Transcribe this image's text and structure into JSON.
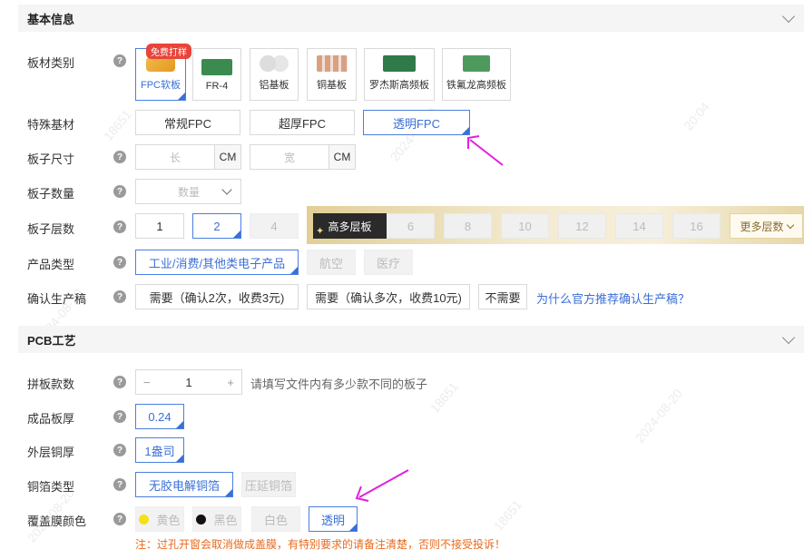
{
  "sections": {
    "basic_title": "基本信息",
    "pcb_title": "PCB工艺"
  },
  "help_glyph": "?",
  "material": {
    "label": "板材类别",
    "badge": "免费打样",
    "options": [
      "FPC软板",
      "FR-4",
      "铝基板",
      "铜基板",
      "罗杰斯高频板",
      "铁氟龙高频板"
    ],
    "selected": "FPC软板"
  },
  "special_substrate": {
    "label": "特殊基材",
    "options": [
      "常规FPC",
      "超厚FPC",
      "透明FPC"
    ],
    "selected": "透明FPC"
  },
  "board_size": {
    "label": "板子尺寸",
    "length_placeholder": "长",
    "width_placeholder": "宽",
    "unit": "CM"
  },
  "board_quantity": {
    "label": "板子数量",
    "placeholder": "数量"
  },
  "layers": {
    "label": "板子层数",
    "options": [
      "1",
      "2",
      "4"
    ],
    "selected": "2",
    "high_multi_label": "高多层板",
    "high_options": [
      "6",
      "8",
      "10",
      "12",
      "14",
      "16"
    ],
    "more_label": "更多层数"
  },
  "product_type": {
    "label": "产品类型",
    "options": [
      "工业/消费/其他类电子产品",
      "航空",
      "医疗"
    ],
    "selected": "工业/消费/其他类电子产品"
  },
  "confirm_production": {
    "label": "确认生产稿",
    "options": [
      "需要（确认2次，收费3元)",
      "需要（确认多次，收费10元)",
      "不需要"
    ],
    "link": "为什么官方推荐确认生产稿？"
  },
  "panel_count": {
    "label": "拼板款数",
    "value": "1",
    "minus": "−",
    "plus": "+",
    "hint": "请填写文件内有多少款不同的板子"
  },
  "thickness": {
    "label": "成品板厚",
    "value": "0.24"
  },
  "outer_copper": {
    "label": "外层铜厚",
    "value": "1盎司"
  },
  "foil_type": {
    "label": "铜箔类型",
    "options": [
      "无胶电解铜箔",
      "压延铜箔"
    ],
    "selected": "无胶电解铜箔"
  },
  "coverlay_color": {
    "label": "覆盖膜颜色",
    "options": [
      "黄色",
      "黑色",
      "白色",
      "透明"
    ],
    "selected": "透明",
    "note": "注：过孔开窗会取消做成盖膜，有特别要求的请备注清楚，否则不接受投诉！"
  },
  "watermark": [
    "18651",
    "2024-08-20",
    "20:04"
  ],
  "colors": {
    "accent": "#3a6fd6",
    "annotation_arrow": "#e020e0",
    "warning": "#e86a1c",
    "yellow_dot": "#f5e11a",
    "black_dot": "#111111"
  }
}
